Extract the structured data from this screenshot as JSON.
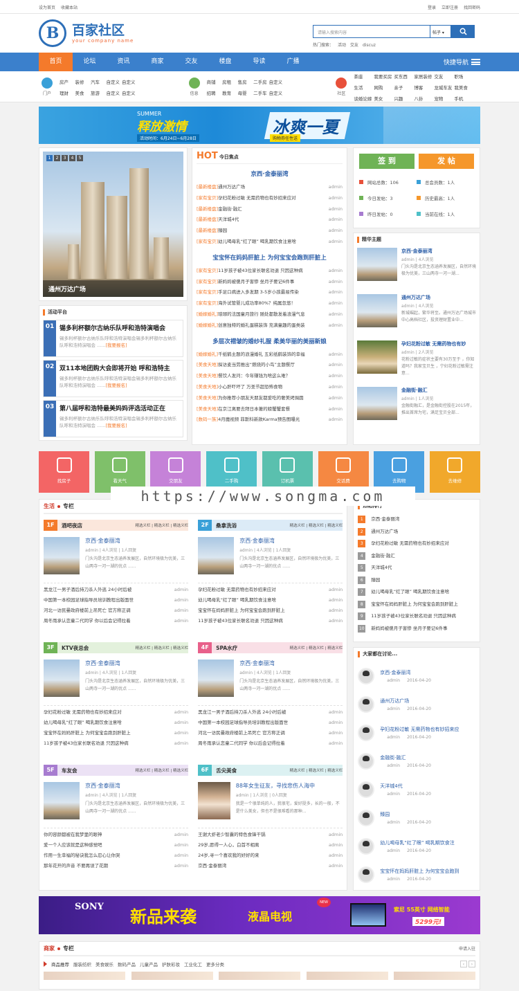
{
  "topbar": {
    "left": [
      "设为首页",
      "收藏本站"
    ],
    "right": [
      "登录",
      "立即注册",
      "找回密码"
    ]
  },
  "logo": {
    "letter": "B",
    "title": "百家社区",
    "subtitle": "your company name"
  },
  "search": {
    "placeholder": "请输入搜索内容",
    "select": "帖子",
    "hot_label": "热门搜索：",
    "hot": [
      "活动",
      "交友",
      "discuz"
    ]
  },
  "nav": {
    "items": [
      "首页",
      "论坛",
      "资讯",
      "商家",
      "交友",
      "楼盘",
      "导读",
      "广播"
    ],
    "quick": "快捷导航"
  },
  "subnav": [
    {
      "label": "门户",
      "color": "#3aa0d8",
      "links": [
        "房产",
        "装修",
        "汽车",
        "自定义",
        "自定义",
        "",
        "理财",
        "美食",
        "旅游",
        "自定义",
        "自定义",
        ""
      ]
    },
    {
      "label": "信息",
      "color": "#6fb356",
      "links": [
        "商铺",
        "房租",
        "售房",
        "二手房",
        "自定义",
        "",
        "招聘",
        "教育",
        "母婴",
        "二手车",
        "自定义",
        ""
      ]
    },
    {
      "label": "社区",
      "color": "#e8503a",
      "links": [
        "茶座",
        "我要买房",
        "买东西",
        "家居装修",
        "交友",
        "职场",
        "生活",
        "网购",
        "亲子",
        "博客",
        "龙城车友",
        "我美食",
        "谈婚论嫁",
        "美女",
        "兴趣",
        "八卦",
        "宠物",
        "手机"
      ]
    }
  ],
  "banner1": {
    "summer": "SUMMER",
    "big": "释放激情",
    "date": "活动时间：6月24日~6月28日",
    "big2": "冰爽一夏",
    "tag": "购物券任性送"
  },
  "slider": {
    "dots": [
      "1",
      "2",
      "3",
      "4",
      "5"
    ],
    "caption": "通州万达广场"
  },
  "activity": {
    "title": "活动平台",
    "more": "[我要报名]",
    "items": [
      {
        "num": "01",
        "title": "锡多利杯额尔古纳乐队呼和浩特演唱会",
        "desc": "锡多利杯额尔古纳乐队呼和浩特演唱会锡多利杯额尔古纳乐队呼和浩特演唱会 ......"
      },
      {
        "num": "02",
        "title": "双11本地团购大会即将开始 呼和浩特主",
        "desc": "锡多利杯额尔古纳乐队呼和浩特演唱会锡多利杯额尔古纳乐队呼和浩特演唱会 ......"
      },
      {
        "num": "03",
        "title": "第八届呼和浩特最美妈妈评选活动正在",
        "desc": "锡多利杯额尔古纳乐队呼和浩特演唱会锡多利杯额尔古纳乐队呼和浩特演唱会 ......"
      }
    ]
  },
  "hot": {
    "hot": "HOT",
    "focus": "今日焦点",
    "groups": [
      {
        "title": "京西·金泰丽湾",
        "items": [
          [
            "[最新楼盘]",
            "通州万达广场",
            "admin"
          ],
          [
            "[家有宝贝]",
            "孕妇花粉过敏 无需药物也有妙招来应对",
            "admin"
          ],
          [
            "[最新楼盘]",
            "金融街·融汇",
            "admin"
          ],
          [
            "[最新楼盘]",
            "天洋城4代",
            "admin"
          ],
          [
            "[最新楼盘]",
            "臻园",
            "admin"
          ],
          [
            "[家有宝贝]",
            "幼儿喝母乳“红了眼” 喝乳期饮食注意啥",
            "admin"
          ]
        ]
      },
      {
        "title": "宝宝怀在妈妈肝脏上 为何宝宝会跑到肝脏上",
        "items": [
          [
            "[家有宝贝]",
            "11岁孩子被43位家长联名劝退 只因这种病",
            "admin"
          ],
          [
            "[家有宝贝]",
            "新妈妈被傻月子害惨 坐月子要记6件事",
            "admin"
          ],
          [
            "[家有宝贝]",
            "手足口病进入多发期 3-5岁小孩最易传染",
            "admin"
          ],
          [
            "[家有宝贝]",
            "海外试管婴儿成功率80%？纯属忽悠！",
            "admin"
          ],
          [
            "[婚嫁婚礼]",
            "琅琊的法国童月旅行 随处都散发着浪漫气息",
            "admin"
          ],
          [
            "[婚嫁婚礼]",
            "创意独特的婚礼蛋糕装饰 充满童趣的蛋类装",
            "admin"
          ]
        ]
      },
      {
        "title": "多层次褶皱的婚纱礼服 柔美华丽的美丽新娘",
        "items": [
          [
            "[婚嫁婚礼]",
            "千纸鹤主题的浪漫婚礼 五彩纸鹤装饰的幸福",
            "admin"
          ],
          [
            "[美食天地]",
            "探访麦当劳推出“燃烧的小鸟”主题餐厅",
            "admin"
          ],
          [
            "[美食天地]",
            "餐饮人发问：今年赚钱为啥这么难？",
            "admin"
          ],
          [
            "[美食天地]",
            "小心肝吓坏了 万圣节超恐怖食物",
            "admin"
          ],
          [
            "[美食天地]",
            "为你推荐小朋友天朋友都爱吃的奢美烤焗圆",
            "admin"
          ],
          [
            "[美食天地]",
            "在京江离要去拜日本著的螃蟹蟹套餐",
            "admin"
          ],
          [
            "[数码一族]",
            "4月魔视频 菲斯科新款Karma预告图曝光",
            "admin"
          ]
        ]
      }
    ]
  },
  "actions": {
    "sign": "签 到",
    "post": "发 帖",
    "stats": [
      "网站总数：106",
      "总会员数：1人",
      "今日发帖：3",
      "历史最高：1人",
      "昨日发帖：0",
      "当前在线：1人"
    ]
  },
  "essence": {
    "title": "精华主题",
    "items": [
      {
        "title": "京西·金泰丽湾",
        "meta": "admin | 4人浏览",
        "desc": "门头沟是北京生态涵养发展区，自然环境极为优美，三山两寺一河一湖..."
      },
      {
        "title": "通州万达广场",
        "meta": "admin | 4人浏览",
        "desc": "新城崛起，繁华将至。通州万达广场城市中心高档社区，投资理财置业中..."
      },
      {
        "title": "孕妇花粉过敏 无需药物也有妙",
        "meta": "admin | 2人浏览",
        "desc": "花粉过敏的症状主要有30万至于 ，你知道吗？我家宝贝生 ，宁妇花粉过敏需注意..."
      },
      {
        "title": "金融街·融汇",
        "meta": "admin | 1人浏览",
        "desc": "金融街融汇，是金融街控股在2015年，推出首席为宅，满足宝贝全部..."
      }
    ]
  },
  "tiles": [
    {
      "label": "找房子",
      "color": "#f36565"
    },
    {
      "label": "看天气",
      "color": "#7fc06a"
    },
    {
      "label": "交朋友",
      "color": "#c582d8"
    },
    {
      "label": "二手购",
      "color": "#4fc0c8"
    },
    {
      "label": "订机票",
      "color": "#5ac0ae"
    },
    {
      "label": "交话费",
      "color": "#f58842"
    },
    {
      "label": "去购物",
      "color": "#4aa0e0"
    },
    {
      "label": "去维修",
      "color": "#f1a82b"
    }
  ],
  "watermark": "https://www.songma.com",
  "life": {
    "a": "生活",
    "b": "专栏",
    "tabs": "精选义栏 | 精选义栏 | 精选义栏",
    "boxes": [
      {
        "floor": "1F",
        "name": "酒吧夜店",
        "color": "#f47a2b",
        "bg": "#fbe7dc",
        "img": "",
        "title": "京西·金泰丽湾",
        "meta": "admin | 4人浏览 | 1人回复",
        "desc": "门头沟是北京生态涵养发展区，自然环境极为优美，三山两寺一河一湖的优点 ......",
        "items": [
          [
            "黑龙江一男子酒后持刀杀人外逃 24小时后被",
            "admin"
          ],
          [
            "中国第一本校园足球指导员培训教程出版面世",
            "admin"
          ],
          [
            "河北一访民曼政府楼前上吊死亡 官方称正调",
            "admin"
          ],
          [
            "周冬雨承认恋童二代同学 你以后会记得拉着",
            "admin"
          ]
        ]
      },
      {
        "floor": "2F",
        "name": "桑拿洗浴",
        "color": "#3aa0d8",
        "bg": "#dcebf7",
        "img": "",
        "title": "京西·金泰丽湾",
        "meta": "admin | 4人浏览 | 1人回复",
        "desc": "门头沟是北京生态涵养发展区，自然环境极为优美，三山两寺一河一湖的优点 ......",
        "items": [
          [
            "孕妇花粉过敏 无需药物也有妙招来应对",
            "admin"
          ],
          [
            "幼儿喝母乳“红了眼” 喝乳期饮食注意啥",
            "admin"
          ],
          [
            "宝宝怀在妈妈肝脏上 为何宝宝会跑到肝脏上",
            "admin"
          ],
          [
            "11岁孩子被43位家长联名劝退 只因这种病",
            "admin"
          ]
        ]
      },
      {
        "floor": "3F",
        "name": "KTV夜总会",
        "color": "#6fb356",
        "bg": "#e3f1dc",
        "img": "",
        "title": "京西·金泰丽湾",
        "meta": "admin | 4人浏览 | 1人回复",
        "desc": "门头沟是北京生态涵养发展区，自然环境极为优美，三山两寺一河一湖的优点 ......",
        "items": [
          [
            "孕妇花粉过敏 无需药物也有妙招来应对",
            "admin"
          ],
          [
            "幼儿喝母乳“红了眼” 喝乳期饮食注意啥",
            "admin"
          ],
          [
            "宝宝怀在妈妈肝脏上 为何宝宝会跑到肝脏上",
            "admin"
          ],
          [
            "11岁孩子被43位家长联名劝退 只因这种病",
            "admin"
          ]
        ]
      },
      {
        "floor": "4F",
        "name": "SPA水疗",
        "color": "#e8608a",
        "bg": "#f9dfe6",
        "img": "",
        "title": "京西·金泰丽湾",
        "meta": "admin | 4人浏览 | 1人回复",
        "desc": "门头沟是北京生态涵养发展区，自然环境极为优美，三山两寺一河一湖的优点 ......",
        "items": [
          [
            "黑龙江一男子酒后持刀杀人外逃 24小时后被",
            "admin"
          ],
          [
            "中国第一本校园足球指导员培训教程出版面世",
            "admin"
          ],
          [
            "河北一访民曼政府楼前上吊死亡 官方称正调",
            "admin"
          ],
          [
            "周冬雨承认恋童二代同学 你以后会记得拉着",
            "admin"
          ]
        ]
      },
      {
        "floor": "5F",
        "name": "车友会",
        "color": "#a77cd0",
        "bg": "#ece2f5",
        "img": "",
        "title": "京西·金泰丽湾",
        "meta": "admin | 4人浏览 | 1人回复",
        "desc": "门头沟是北京生态涵养发展区，自然环境极为优美，三山两寺一河一湖的优点 ......",
        "items": [
          [
            "你的容颜都被在我梦里的眼神",
            "admin"
          ],
          [
            "爱一个人应该就是这种感觉吧",
            "admin"
          ],
          [
            "作用一生幸福的秘诀我怎么忍心让你哭",
            "admin"
          ],
          [
            "那年花开的声音 不要再误了花期",
            "admin"
          ]
        ]
      },
      {
        "floor": "6F",
        "name": "舌尖美食",
        "color": "#4fc0c8",
        "bg": "#dcf1f2",
        "img": "girl",
        "title": "88年女生征友，寻找悲伤人海中",
        "meta": "admin | 1人浏览 | 0人回复",
        "desc": "我是一个很单纯的人，我很宅，爱好挺多，长的一般，不是什么美女，但也不是很难看的那种...",
        "items": [
          [
            "王谢大虾老少智囊的特色食锋干锅",
            "admin"
          ],
          [
            "29岁,愿得一人心，白首不相离",
            "admin"
          ],
          [
            "24岁,寻一个喜欢我的好好的来",
            "admin"
          ],
          [
            "京西·金泰丽湾",
            "admin"
          ]
        ]
      }
    ]
  },
  "rank": {
    "title": "热帖排行",
    "items": [
      "京西·金泰丽湾",
      "通州万达广场",
      "孕妇花粉过敏 无需药物也有妙招来应对",
      "金融街·融汇",
      "天洋城4代",
      "臻园",
      "幼儿喝母乳“红了眼” 喝乳期饮食注意啥",
      "宝宝怀在妈妈肝脏上 为何宝宝会跑到肝脏上",
      "11岁孩子被43位家长联名劝退 只因这种病",
      "新妈妈被傻月子害惨 坐月子要记6件事"
    ]
  },
  "discuss": {
    "title": "大家都在讨论...",
    "items": [
      {
        "title": "京西·金泰丽湾",
        "user": "admin",
        "date": "2016-04-20"
      },
      {
        "title": "通州万达广场",
        "user": "admin",
        "date": "2016-04-20"
      },
      {
        "title": "孕妇花粉过敏 无需药物也有妙招来应",
        "user": "admin",
        "date": "2016-04-20"
      },
      {
        "title": "金融街·融汇",
        "user": "admin",
        "date": "2016-04-20"
      },
      {
        "title": "天洋城4代",
        "user": "admin",
        "date": "2016-04-20"
      },
      {
        "title": "臻园",
        "user": "admin",
        "date": "2016-04-20"
      },
      {
        "title": "幼儿喝母乳“红了眼” 喝乳期饮食注",
        "user": "admin",
        "date": "2016-04-20"
      },
      {
        "title": "宝宝怀在妈妈肝脏上 为何宝宝会跑到",
        "user": "admin",
        "date": "2016-04-20"
      }
    ]
  },
  "banner2": {
    "sony": "SONY",
    "big": "新品来袭",
    "big2": "液晶电视",
    "new": "NEW",
    "r1": "索尼 55英寸 网络智能",
    "r2": "5299元!"
  },
  "shop": {
    "a": "商家",
    "b": "专栏",
    "right": "申请入驻",
    "sub": "商品推荐",
    "cats": [
      "服装纺织",
      "美食娱乐",
      "数码产品",
      "儿童产品",
      "护肤彩妆",
      "工业化工",
      "更多分类"
    ]
  }
}
